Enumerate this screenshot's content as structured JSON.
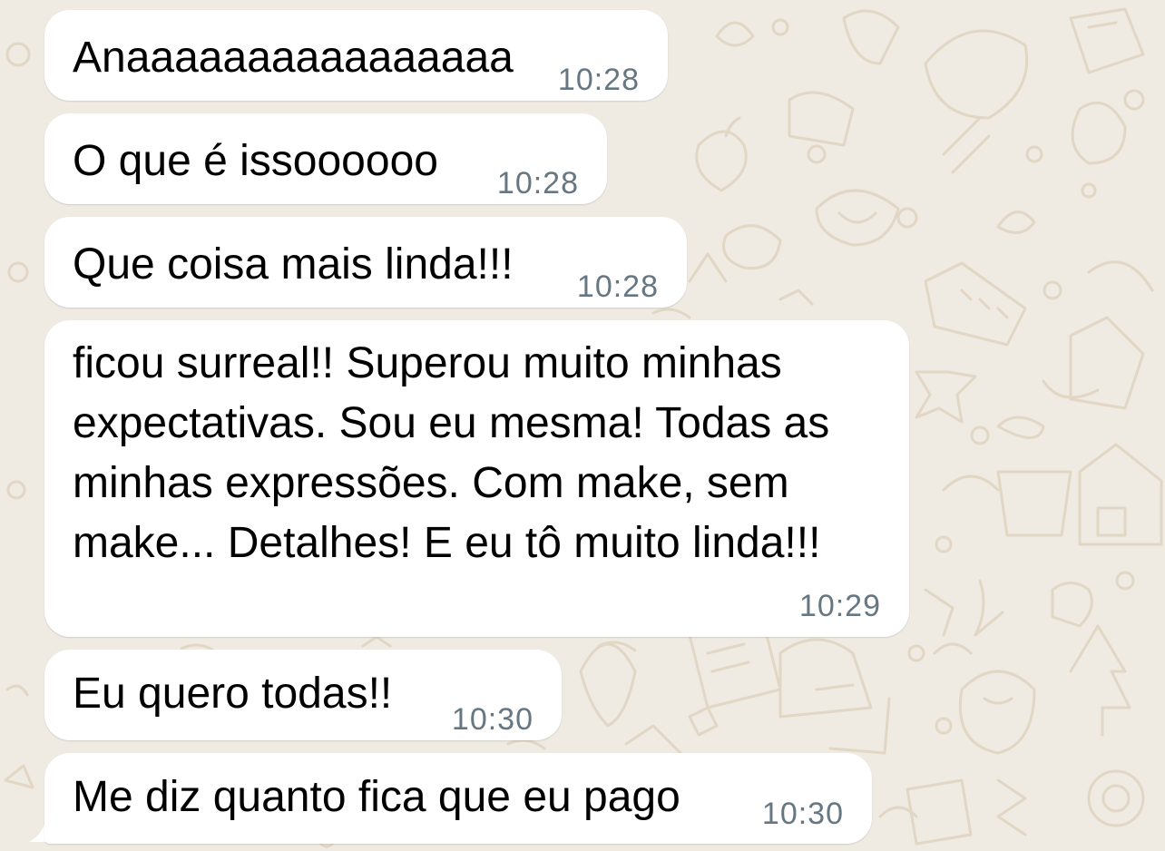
{
  "chat": {
    "messages": [
      {
        "text": "Anaaaaaaaaaaaaaaaa",
        "time": "10:28"
      },
      {
        "text": "O que é issoooooo",
        "time": "10:28"
      },
      {
        "text": "Que coisa mais linda!!!",
        "time": "10:28"
      },
      {
        "text": "ficou surreal!! Superou muito minhas expectativas. Sou eu mesma! Todas as minhas expressões. Com make, sem make... Detalhes! E eu tô muito linda!!!",
        "time": "10:29"
      },
      {
        "text": "Eu quero todas!!",
        "time": "10:30"
      },
      {
        "text": "Me diz quanto fica que eu pago",
        "time": "10:30"
      }
    ]
  },
  "colors": {
    "wallpaper": "#efeae2",
    "bubble_incoming": "#ffffff",
    "timestamp": "#667781"
  }
}
